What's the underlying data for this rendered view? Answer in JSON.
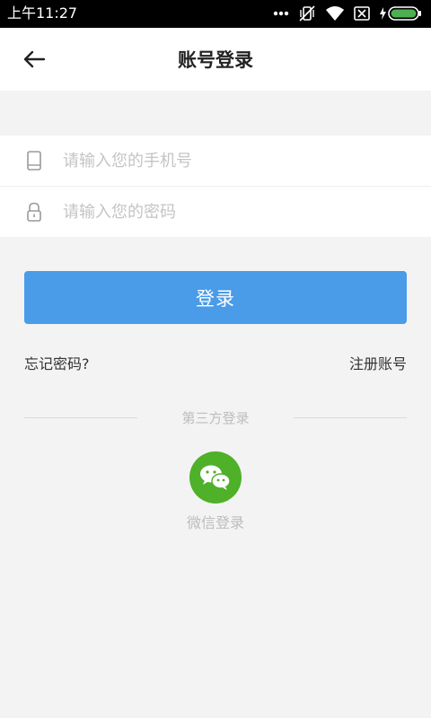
{
  "status_bar": {
    "time": "上午11:27"
  },
  "header": {
    "title": "账号登录"
  },
  "form": {
    "phone_placeholder": "请输入您的手机号",
    "password_placeholder": "请输入您的密码"
  },
  "login_button": "登录",
  "links": {
    "forgot": "忘记密码?",
    "register": "注册账号"
  },
  "third_party": {
    "label": "第三方登录",
    "wechat_label": "微信登录"
  },
  "colors": {
    "primary": "#4a9be8",
    "wechat": "#4fb02a",
    "background": "#f3f3f3"
  }
}
